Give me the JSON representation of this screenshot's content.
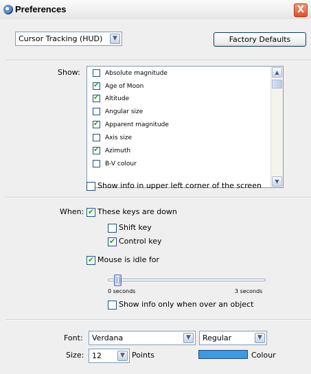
{
  "window": {
    "title": "Preferences",
    "close_glyph": "X",
    "app_icon": "globe-icon"
  },
  "top": {
    "category_value": "Cursor Tracking (HUD)",
    "factory_defaults_label": "Factory Defaults"
  },
  "show": {
    "label": "Show:",
    "items": [
      {
        "label": "Absolute magnitude",
        "checked": false
      },
      {
        "label": "Age of Moon",
        "checked": true
      },
      {
        "label": "Altitude",
        "checked": true
      },
      {
        "label": "Angular size",
        "checked": false
      },
      {
        "label": "Apparent magnitude",
        "checked": true
      },
      {
        "label": "Axis size",
        "checked": false
      },
      {
        "label": "Azimuth",
        "checked": true
      },
      {
        "label": "B-V colour",
        "checked": false
      }
    ],
    "upper_left_label": "Show info in upper left corner of the screen",
    "upper_left_checked": false
  },
  "when": {
    "label": "When:",
    "keys_down_label": "These keys are down",
    "keys_down_checked": true,
    "shift_label": "Shift key",
    "shift_checked": false,
    "control_label": "Control key",
    "control_checked": true,
    "idle_label": "Mouse is idle for",
    "idle_checked": true,
    "slider_min_label": "0 seconds",
    "slider_max_label": "3 seconds",
    "slider_fraction": 0.05,
    "over_object_label": "Show info only when over an object",
    "over_object_checked": false
  },
  "font": {
    "label": "Font:",
    "family_value": "Verdana",
    "style_value": "Regular",
    "size_label": "Size:",
    "size_value": "12",
    "points_label": "Points",
    "colour_label": "Colour",
    "colour": "#3c9ae2"
  }
}
